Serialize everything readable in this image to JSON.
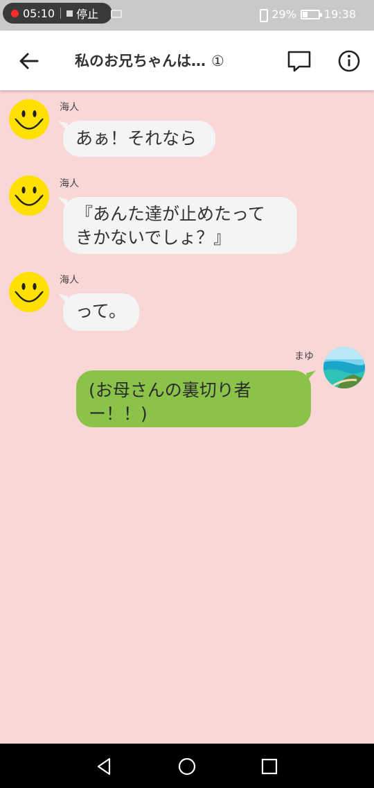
{
  "status_bar": {
    "record_time": "05:10",
    "stop_label": "停止",
    "battery_percent": "29%",
    "clock": "19:38",
    "icons": [
      "record-dot-icon",
      "stop-square-icon",
      "vibrate-icon",
      "battery-icon"
    ]
  },
  "app_bar": {
    "title": "私のお兄ちゃんは…",
    "chapter_marker": "①",
    "icons": [
      "arrow-left-icon",
      "comment-icon",
      "info-icon"
    ]
  },
  "messages": [
    {
      "sender": "海人",
      "text": "あぁ！それなら",
      "side": "left",
      "avatar": "smiley-face-icon"
    },
    {
      "sender": "海人",
      "text": "『あんた達が止めたって\nきかないでしょ？』",
      "side": "left",
      "avatar": "smiley-face-icon"
    },
    {
      "sender": "海人",
      "text": "って。",
      "side": "left",
      "avatar": "smiley-face-icon"
    },
    {
      "sender": "まゆ",
      "text": "(お母さんの裏切り者\nー！！)",
      "side": "right",
      "avatar": "beach-photo-avatar"
    }
  ],
  "colors": {
    "chat_background": "#f9d7d7",
    "incoming_bubble": "#f4f4f4",
    "outgoing_bubble": "#8bc34a",
    "smiley_yellow": "#ffe000"
  },
  "nav_bar": {
    "icons": [
      "triangle-back-icon",
      "circle-home-icon",
      "square-recents-icon"
    ]
  }
}
